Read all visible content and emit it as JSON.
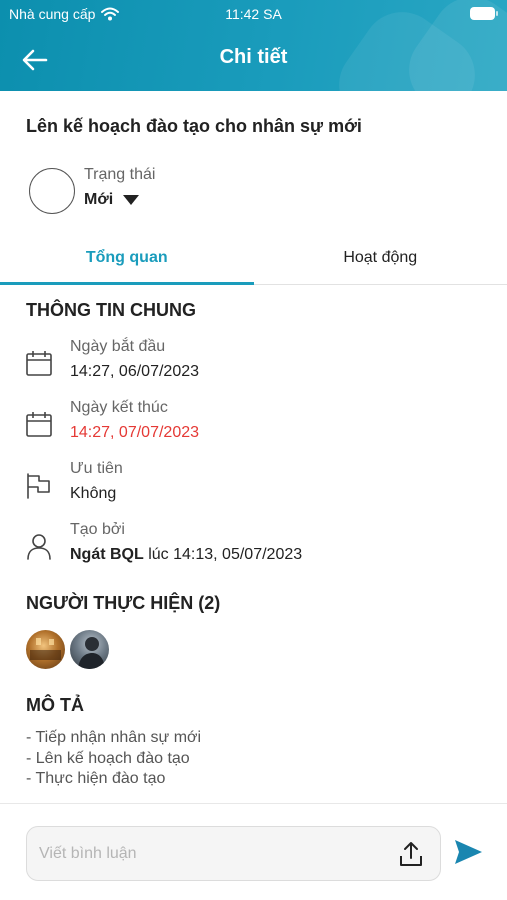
{
  "status_bar": {
    "carrier": "Nhà cung cấp",
    "time": "11:42 SA"
  },
  "header": {
    "title": "Chi tiết"
  },
  "task": {
    "title": "Lên kế hoạch đào tạo cho nhân sự mới",
    "status_label": "Trạng thái",
    "status_value": "Mới"
  },
  "tabs": [
    {
      "label": "Tổng quan",
      "active": true
    },
    {
      "label": "Hoạt động",
      "active": false
    }
  ],
  "general": {
    "heading": "THÔNG TIN CHUNG",
    "start": {
      "label": "Ngày bắt đầu",
      "value": "14:27, 06/07/2023"
    },
    "end": {
      "label": "Ngày kết thúc",
      "value": "14:27, 07/07/2023"
    },
    "priority": {
      "label": "Ưu tiên",
      "value": "Không"
    },
    "created": {
      "label": "Tạo bởi",
      "author": "Ngát BQL",
      "rest": " lúc 14:13, 05/07/2023"
    }
  },
  "assignees": {
    "heading": "NGƯỜI THỰC HIỆN (2)",
    "count": 2
  },
  "description": {
    "heading": "MÔ TẢ",
    "lines": [
      "- Tiếp nhận nhân sự mới",
      "- Lên kế hoạch đào tạo",
      "- Thực hiện đào tạo"
    ]
  },
  "comment": {
    "placeholder": "Viết bình luận"
  },
  "colors": {
    "primary": "#1a9cbc",
    "overdue": "#e53935"
  },
  "icons": [
    "wifi-icon",
    "battery-icon",
    "back-arrow-icon",
    "calendar-icon",
    "flag-icon",
    "user-icon",
    "upload-icon",
    "send-icon"
  ]
}
